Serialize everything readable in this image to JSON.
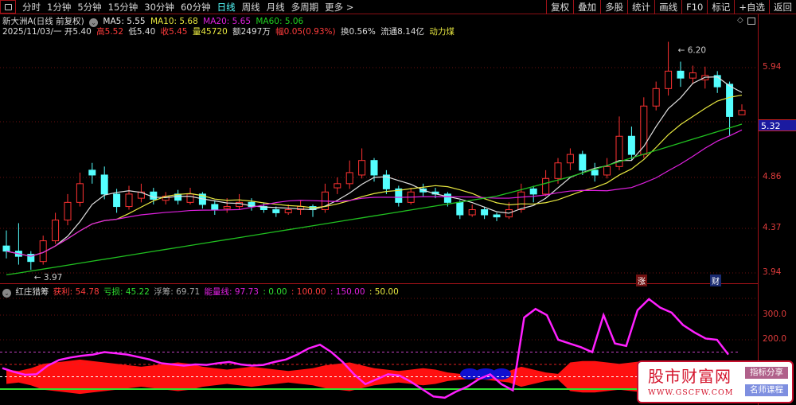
{
  "toolbar": {
    "periods": [
      "分时",
      "1分钟",
      "5分钟",
      "15分钟",
      "30分钟",
      "60分钟",
      "日线",
      "周线",
      "月线",
      "多周期",
      "更多 >"
    ],
    "active_index": 6,
    "buttons": [
      "复权",
      "叠加",
      "多股",
      "统计",
      "画线",
      "F10",
      "标记",
      "+自选",
      "返回"
    ]
  },
  "header": {
    "title": "新大洲A(日线 前复权)",
    "ma5": "MA5: 5.55",
    "ma10": "MA10: 5.68",
    "ma20": "MA20: 5.65",
    "ma60": "MA60: 5.06",
    "date": "2025/11/03/一",
    "open": "开5.40",
    "high": "高5.52",
    "low": "低5.40",
    "close": "收5.45",
    "volume": "量45720",
    "amount": "额2497万",
    "change": "幅0.05(0.93%)",
    "turnover": "换0.56%",
    "float": "流通8.14亿",
    "sector": "动力煤"
  },
  "price_axis": {
    "labels": [
      "5.94",
      "4.86",
      "4.37",
      "3.94"
    ],
    "current": "5.32"
  },
  "annotations": {
    "max": "6.20",
    "min": "3.97",
    "tag1": "涨",
    "tag2": "财"
  },
  "indicator": {
    "name": "红庄猎筹",
    "profit": "获利: 54.78",
    "loss": "亏损: 45.22",
    "float_chips": "浮筹: 69.71",
    "energy": "能量线: 97.73",
    "l0": ": 0.00",
    "l100": ": 100.00",
    "l150": ": 150.00",
    "l50": ": 50.00",
    "axis": [
      "300.0",
      "200.0"
    ]
  },
  "watermark": {
    "title": "股市财富网",
    "url": "WWW.GSCFW.COM",
    "btn1": "指标分享",
    "btn2": "名师课程"
  },
  "colors": {
    "up": "#ff3232",
    "down": "#54ffff",
    "ma5": "#e0e0e0",
    "ma10": "#e8e840",
    "ma20": "#e020e0",
    "ma60": "#20c020"
  },
  "chart_data": {
    "type": "candlestick",
    "ohlc": [
      [
        4.2,
        4.35,
        4.08,
        4.15
      ],
      [
        4.15,
        4.42,
        4.02,
        4.1
      ],
      [
        4.12,
        4.15,
        3.97,
        4.05
      ],
      [
        4.05,
        4.3,
        4.02,
        4.25
      ],
      [
        4.25,
        4.52,
        4.22,
        4.45
      ],
      [
        4.45,
        4.7,
        4.4,
        4.62
      ],
      [
        4.62,
        4.9,
        4.58,
        4.8
      ],
      [
        4.92,
        4.98,
        4.8,
        4.88
      ],
      [
        4.88,
        4.95,
        4.65,
        4.7
      ],
      [
        4.7,
        4.75,
        4.52,
        4.58
      ],
      [
        4.58,
        4.78,
        4.55,
        4.7
      ],
      [
        4.66,
        4.8,
        4.62,
        4.72
      ],
      [
        4.72,
        4.76,
        4.6,
        4.65
      ],
      [
        4.64,
        4.72,
        4.6,
        4.68
      ],
      [
        4.7,
        4.74,
        4.6,
        4.64
      ],
      [
        4.62,
        4.76,
        4.6,
        4.7
      ],
      [
        4.7,
        4.72,
        4.56,
        4.6
      ],
      [
        4.6,
        4.64,
        4.5,
        4.55
      ],
      [
        4.56,
        4.66,
        4.52,
        4.58
      ],
      [
        4.58,
        4.7,
        4.55,
        4.62
      ],
      [
        4.62,
        4.66,
        4.54,
        4.58
      ],
      [
        4.58,
        4.62,
        4.52,
        4.55
      ],
      [
        4.55,
        4.58,
        4.48,
        4.52
      ],
      [
        4.52,
        4.6,
        4.5,
        4.55
      ],
      [
        4.55,
        4.64,
        4.5,
        4.58
      ],
      [
        4.58,
        4.6,
        4.48,
        4.55
      ],
      [
        4.55,
        4.8,
        4.52,
        4.72
      ],
      [
        4.76,
        4.86,
        4.7,
        4.8
      ],
      [
        4.8,
        5.0,
        4.75,
        4.9
      ],
      [
        4.88,
        5.1,
        4.85,
        5.0
      ],
      [
        5.0,
        5.02,
        4.82,
        4.88
      ],
      [
        4.88,
        4.92,
        4.7,
        4.75
      ],
      [
        4.75,
        4.78,
        4.58,
        4.62
      ],
      [
        4.62,
        4.76,
        4.6,
        4.72
      ],
      [
        4.75,
        4.8,
        4.68,
        4.72
      ],
      [
        4.72,
        4.76,
        4.66,
        4.7
      ],
      [
        4.7,
        4.72,
        4.58,
        4.62
      ],
      [
        4.62,
        4.64,
        4.46,
        4.5
      ],
      [
        4.5,
        4.6,
        4.48,
        4.55
      ],
      [
        4.55,
        4.58,
        4.46,
        4.5
      ],
      [
        4.5,
        4.52,
        4.44,
        4.48
      ],
      [
        4.48,
        4.62,
        4.46,
        4.55
      ],
      [
        4.55,
        4.8,
        4.52,
        4.72
      ],
      [
        4.75,
        4.78,
        4.62,
        4.7
      ],
      [
        4.7,
        4.92,
        4.68,
        4.85
      ],
      [
        4.85,
        5.02,
        4.8,
        4.98
      ],
      [
        4.98,
        5.1,
        4.92,
        5.05
      ],
      [
        5.05,
        5.08,
        4.88,
        4.92
      ],
      [
        4.92,
        4.98,
        4.82,
        4.88
      ],
      [
        4.88,
        5.02,
        4.85,
        4.95
      ],
      [
        4.95,
        5.38,
        4.92,
        5.2
      ],
      [
        5.2,
        5.28,
        5.0,
        5.05
      ],
      [
        5.05,
        5.6,
        5.02,
        5.5
      ],
      [
        5.5,
        5.78,
        5.45,
        5.7
      ],
      [
        5.7,
        6.2,
        5.62,
        5.9
      ],
      [
        5.9,
        6.0,
        5.72,
        5.82
      ],
      [
        5.82,
        5.96,
        5.75,
        5.88
      ],
      [
        5.8,
        5.95,
        5.7,
        5.85
      ],
      [
        5.85,
        5.9,
        5.65,
        5.72
      ],
      [
        5.75,
        5.78,
        5.2,
        5.38
      ],
      [
        5.4,
        5.52,
        5.4,
        5.45
      ]
    ],
    "energy": [
      85,
      70,
      58,
      60,
      95,
      118,
      128,
      135,
      140,
      150,
      145,
      140,
      130,
      120,
      105,
      100,
      95,
      100,
      98,
      105,
      110,
      100,
      95,
      98,
      110,
      120,
      140,
      165,
      180,
      150,
      110,
      60,
      20,
      40,
      60,
      55,
      30,
      0,
      -30,
      -35,
      -10,
      10,
      40,
      60,
      20,
      -5,
      290,
      325,
      300,
      200,
      185,
      170,
      150,
      300,
      185,
      175,
      320,
      365,
      330,
      310,
      260,
      230,
      205,
      200,
      140
    ],
    "profit_band": [
      10,
      8,
      12,
      18,
      20,
      22,
      24,
      22,
      20,
      18,
      16,
      14,
      16,
      18,
      20,
      18,
      14,
      12,
      10,
      12,
      14,
      12,
      10,
      8,
      10,
      12,
      16,
      18,
      20,
      16,
      12,
      10,
      8,
      10,
      12,
      10,
      6,
      4,
      3,
      4,
      6,
      8,
      14,
      10,
      6,
      4,
      20,
      22,
      22,
      20,
      18,
      20,
      22,
      20,
      18,
      16,
      14,
      12,
      10,
      8,
      6
    ],
    "ylim_indicator": [
      -60,
      360
    ]
  }
}
